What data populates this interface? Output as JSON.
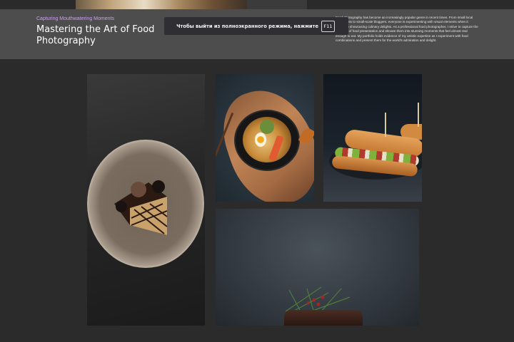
{
  "header": {
    "eyebrow": "Capturing Mouthwatering Moments",
    "title": "Mastering the Art of Food Photography",
    "description": "Food photography has become an increasingly popular genre in recent times. From small local restaurants to small-scale bloggers, everyone is experimenting with visual elements when it comes to showcasing culinary delights. As a professional food photographer, I strive to capture the nuances of food presentation and elevate them into stunning moments that feel almost real enough to eat. My portfolio holds evidence of my artistic expertise as I experiment with food combinations and present them for the world's admiration and delight."
  },
  "toast": {
    "message": "Чтобы выйти из полноэкранного режима, нажмите",
    "key": "F11"
  },
  "gallery": {
    "images": [
      {
        "subject": "chocolate cake slice on ceramic plate"
      },
      {
        "subject": "ramen noodle bowl on wooden board"
      },
      {
        "subject": "submarine sandwiches on dark plate"
      },
      {
        "subject": "steak with rosemary on dark background"
      }
    ]
  },
  "colors": {
    "background": "#2b2b2b",
    "header_bg": "#4d4d4d",
    "eyebrow": "#c8a2e8",
    "toast_bg": "#2f2f33"
  }
}
